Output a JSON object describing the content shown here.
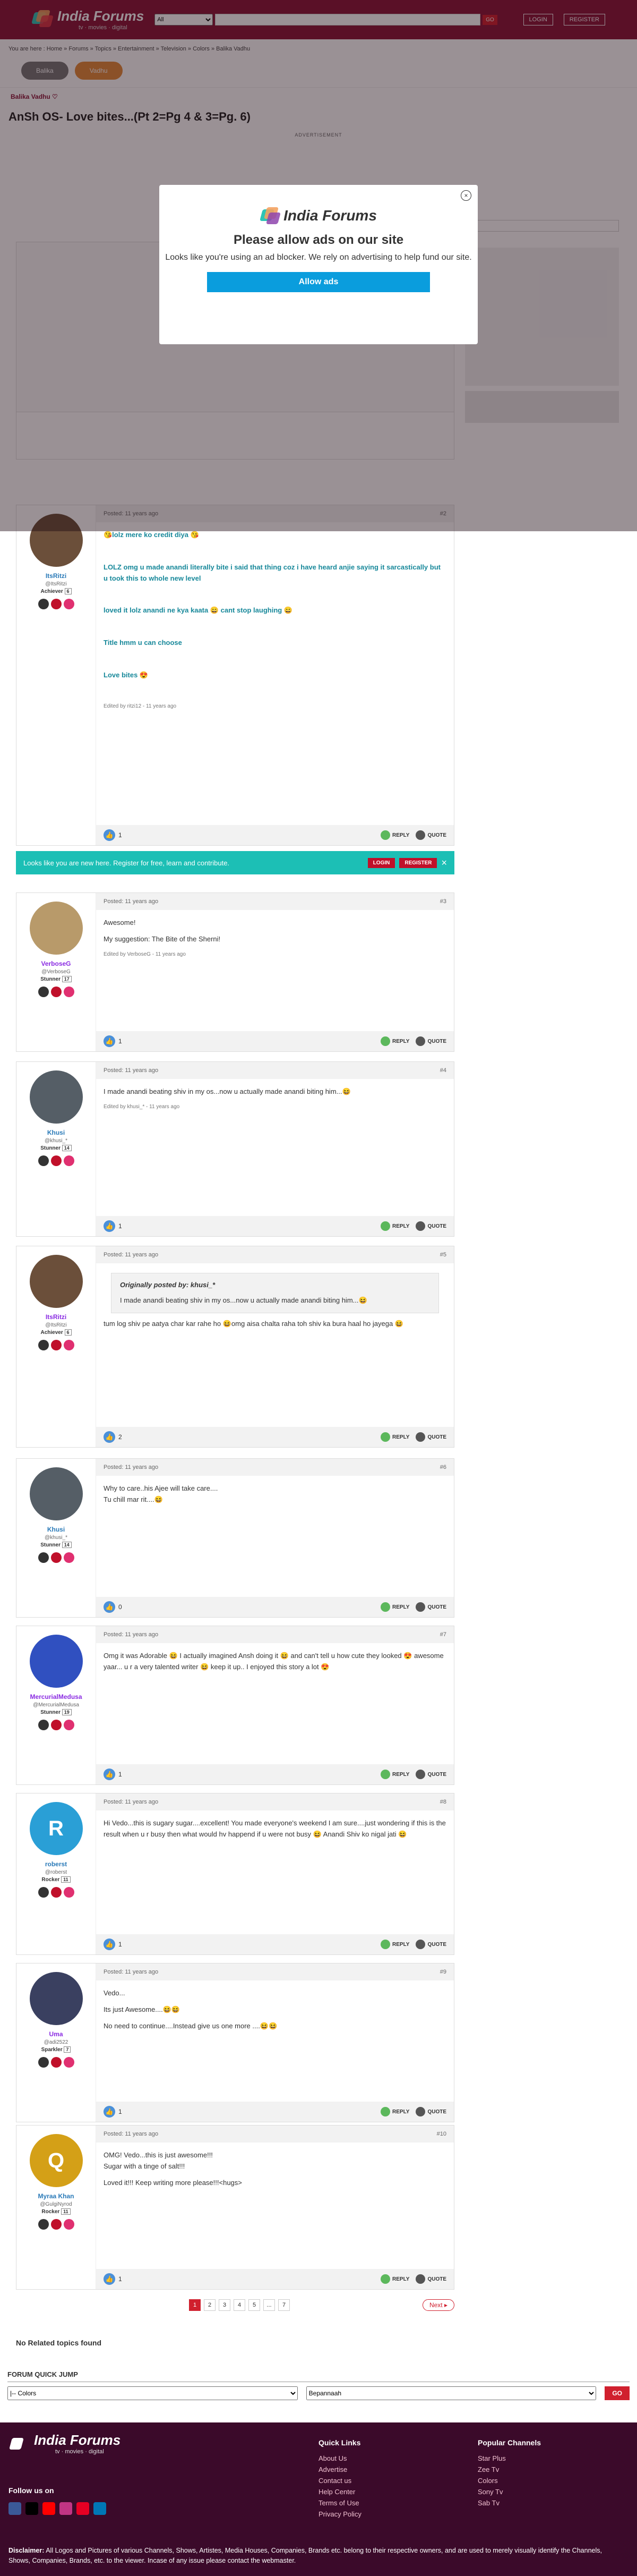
{
  "header": {
    "logo_title": "India Forums",
    "logo_sub": "tv · movies · digital",
    "search_scope": "All",
    "search_placeholder": "",
    "go_label": "GO",
    "login_label": "LOGIN",
    "register_label": "REGISTER"
  },
  "breadcrumb": "You are here : Home » Forums » Topics » Entertainment » Television » Colors » Balika Vadhu",
  "pills": {
    "one": "Balika",
    "two": "Vadhu"
  },
  "forum_name": "Balika Vadhu ♡",
  "topic_title": "AnSh OS- Love bites...(Pt 2=Pg 4 & 3=Pg. 6)",
  "ad_label": "ADVERTISEMENT",
  "modal": {
    "brand": "India Forums",
    "title": "Please allow ads on our site",
    "message": "Looks like you're using an ad blocker. We rely on advertising to help fund our site.",
    "button": "Allow ads",
    "close": "×"
  },
  "register_bar": {
    "text": "Looks like you are new here. Register for free, learn and contribute.",
    "login": "LOGIN",
    "register": "REGISTER",
    "close": "×"
  },
  "colors": {
    "brand": "#8b1538",
    "accent": "#d0202e",
    "teal": "#1cbfb5"
  },
  "labels": {
    "reply": "REPLY",
    "quote": "QUOTE"
  },
  "posts": [
    {
      "user": "ItsRitzi",
      "handle": "@ItsRitzi",
      "rank": "Achiever",
      "rank_no": "6",
      "posted": "Posted: 11 years ago",
      "num": "#2",
      "lines": [
        "😘lolz mere ko credit diya 😘",
        "LOLZ omg u made anandi literally bite i said that thing coz i have heard anjie saying it sarcastically but u took this to whole new level",
        "loved it lolz anandi ne kya kaata 😄 cant stop laughing 😄",
        "Title hmm u can choose",
        "Love bites 😍"
      ],
      "edited": "Edited by ritzi12 - 11 years ago",
      "likes": "1"
    },
    {
      "user": "VerboseG",
      "handle": "@VerboseG",
      "rank": "Stunner",
      "rank_no": "17",
      "posted": "Posted: 11 years ago",
      "num": "#3",
      "lines": [
        "Awesome!",
        "My suggestion: The Bite of the Sherni!"
      ],
      "edited": "Edited by VerboseG - 11 years ago",
      "likes": "1"
    },
    {
      "user": "Khusi",
      "handle": "@khusi_*",
      "rank": "Stunner",
      "rank_no": "14",
      "posted": "Posted: 11 years ago",
      "num": "#4",
      "lines": [
        "I made anandi beating shiv in my os...now u actually made anandi biting him...😆"
      ],
      "edited": "Edited by khusi_* - 11 years ago",
      "likes": "1"
    },
    {
      "user": "ItsRitzi",
      "handle": "@ItsRitzi",
      "rank": "Achiever",
      "rank_no": "6",
      "posted": "Posted: 11 years ago",
      "num": "#5",
      "quote_by": "Originally posted by: khusi_*",
      "quote": "I made anandi beating shiv in my os...now u actually made anandi biting him...😆",
      "lines": [
        "tum log shiv pe aatya char kar rahe ho 😆omg aisa chalta raha toh shiv ka bura haal ho jayega 😆"
      ],
      "edited": "",
      "likes": "2"
    },
    {
      "user": "Khusi",
      "handle": "@khusi_*",
      "rank": "Stunner",
      "rank_no": "14",
      "posted": "Posted: 11 years ago",
      "num": "#6",
      "lines": [
        "Why to care..his Ajee will take care....\nTu chill mar rit....😆"
      ],
      "edited": "",
      "likes": "0"
    },
    {
      "user": "MercurialMedusa",
      "handle": "@MercurialMedusa",
      "rank": "Stunner",
      "rank_no": "19",
      "posted": "Posted: 11 years ago",
      "num": "#7",
      "lines": [
        "Omg it was Adorable 😆 I actually imagined Ansh doing it 😆 and can't tell u how cute they looked 😍 awesome yaar... u r a very talented writer 😆 keep it up.. I enjoyed this story a lot 😍"
      ],
      "edited": "",
      "likes": "1"
    },
    {
      "user": "roberst",
      "handle": "@roberst",
      "rank": "Rocker",
      "rank_no": "11",
      "posted": "Posted: 11 years ago",
      "num": "#8",
      "lines": [
        "Hi Vedo...this is sugary sugar....excellent! You made everyone's weekend I am sure....just wondering if this is the result when u r busy then what would hv happend if u were not busy 😆 Anandi Shiv ko nigal jati 😆"
      ],
      "edited": "",
      "likes": "1"
    },
    {
      "user": "Uma",
      "handle": "@adi2522",
      "rank": "Sparkler",
      "rank_no": "7",
      "posted": "Posted: 11 years ago",
      "num": "#9",
      "lines": [
        "Vedo...",
        "Its just Awesome....😆😆",
        "No need to continue....Instead give us one more ....😆😆"
      ],
      "edited": "",
      "likes": "1"
    },
    {
      "user": "Myraa Khan",
      "handle": "@GulgiNyrod",
      "rank": "Rocker",
      "rank_no": "11",
      "posted": "Posted: 11 years ago",
      "num": "#10",
      "lines": [
        "OMG! Vedo...this is just awesome!!!\nSugar with a tinge of salt!!!",
        "Loved it!!! Keep writing more please!!!<hugs>"
      ],
      "edited": "",
      "likes": "1"
    }
  ],
  "pagination": {
    "pages": [
      "1",
      "2",
      "3",
      "4",
      "5",
      "...",
      "7"
    ],
    "next": "Next ▸"
  },
  "related": "No Related topics found",
  "quickjump": {
    "title": "FORUM QUICK JUMP",
    "select1": "|-- Colors",
    "select2": "Bepannaah",
    "go": "GO"
  },
  "footer": {
    "brand": "India Forums",
    "sub": "tv · movies · digital",
    "follow": "Follow us on",
    "quick_title": "Quick Links",
    "quick": [
      "About Us",
      "Advertise",
      "Contact us",
      "Help Center",
      "Terms of Use",
      "Privacy Policy"
    ],
    "topics_title": "Popular Channels",
    "topics": [
      "Star Plus",
      "Zee Tv",
      "Colors",
      "Sony Tv",
      "Sab Tv"
    ],
    "disclaimer_label": "Disclaimer:",
    "disclaimer": "All Logos and Pictures of various Channels, Shows, Artistes, Media Houses, Companies, Brands etc. belong to their respective owners, and are used to merely visually identify the Channels, Shows, Companies, Brands, etc. to the viewer. Incase of any issue please contact the webmaster."
  }
}
